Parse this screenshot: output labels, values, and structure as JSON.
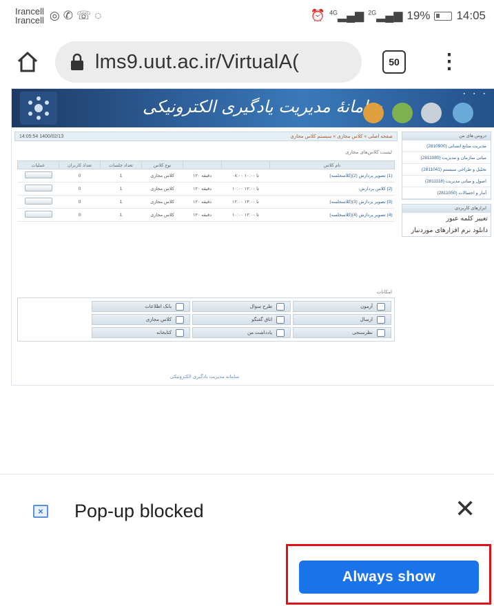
{
  "status_bar": {
    "carrier_1": "Irancell",
    "carrier_2": "Irancell",
    "signal_1": "4G",
    "signal_2": "2G",
    "battery": "19%",
    "time": "14:05"
  },
  "browser": {
    "url": "lms9.uut.ac.ir/VirtualA(",
    "tab_count": "50"
  },
  "site": {
    "banner_title": "سامانهٔ مدیریت یادگیری الکترونیکی",
    "date": "14:05:54 1400/02/13",
    "breadcrumb": "صفحه اصلی » کلاس مجازی » سیستم کلاس مجازی",
    "section_label": "لیست کلاس‌های مجازی",
    "columns": [
      "نام کلاس",
      "",
      "",
      "نوع کلاس",
      "تعداد جلسات",
      "تعداد کاربران",
      "عملیات"
    ],
    "rows": [
      {
        "name": "(1) تصویر پردازش (2)(کلاسجلسه)",
        "time": "۰۸:۰۰ تا ۱۰:۰۰",
        "dur": "۱۲۰ دقیقه",
        "type": "کلاس مجازی",
        "sessions": "1",
        "users": "0"
      },
      {
        "name": "(2) کلاس پردازش",
        "time": "۱۰:۰۰ تا ۱۲:۰۰",
        "dur": "۱۲۰ دقیقه",
        "type": "کلاس مجازی",
        "sessions": "1",
        "users": "0"
      },
      {
        "name": "(3) تصویر پردازش (3)(کلاسجلسه)",
        "time": "۱۲:۰۰ تا ۱۴:۰۰",
        "dur": "۱۲۰ دقیقه",
        "type": "کلاس مجازی",
        "sessions": "1",
        "users": "0"
      },
      {
        "name": "(4) تصویر پردازش (4)(کلاسجلسه)",
        "time": "۱۰:۰۰ تا ۱۲:۰۰",
        "dur": "۱۲۰ دقیقه",
        "type": "کلاس مجازی",
        "sessions": "1",
        "users": "0"
      }
    ],
    "tools_label": "امکانات",
    "tools": [
      "آزمون",
      "طرح سوال",
      "بانک اطلاعات",
      "ارسال",
      "اتاق گفتگو",
      "کلاس مجازی",
      "نظرسنجی",
      "یادداشت من",
      "کتابخانه"
    ],
    "footer": "سامانه مدیریت یادگیری الکترونیکی",
    "side_box1_head": "دروس های من",
    "side_box1_items": [
      "مدیریت منابع انسانی (2810900)",
      "مبانی سازمان و مدیریت (2811080)",
      "تحلیل و طراحی سیستم (2811041)",
      "اصول و مبانی مدیریت (2811118)",
      "آمار و احتمالات (2811050)"
    ],
    "side_box2_head": "ابزارهای کاربردی",
    "side_links": [
      "تغییر کلمه عبور",
      "دانلود نرم افزارهای موردنیاز"
    ]
  },
  "popup": {
    "message": "Pop-up blocked",
    "button": "Always show"
  }
}
